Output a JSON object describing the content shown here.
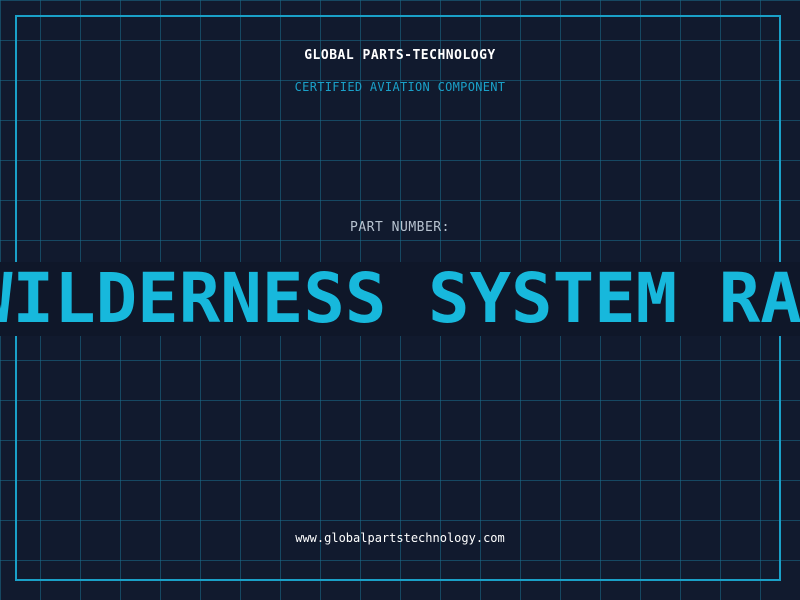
{
  "header": {
    "brand": "GLOBAL PARTS-TECHNOLOGY",
    "certification": "CERTIFIED AVIATION COMPONENT"
  },
  "part": {
    "label": "PART NUMBER:",
    "value": "WILDERNESS SYSTEM RADAR"
  },
  "footer": {
    "url": "www.globalpartstechnology.com"
  },
  "colors": {
    "background": "#111a2e",
    "grid": "#1a6e8c",
    "frame": "#1aa0c8",
    "accent": "#17b8dc",
    "label": "#b8c3d0",
    "text": "#ffffff"
  }
}
